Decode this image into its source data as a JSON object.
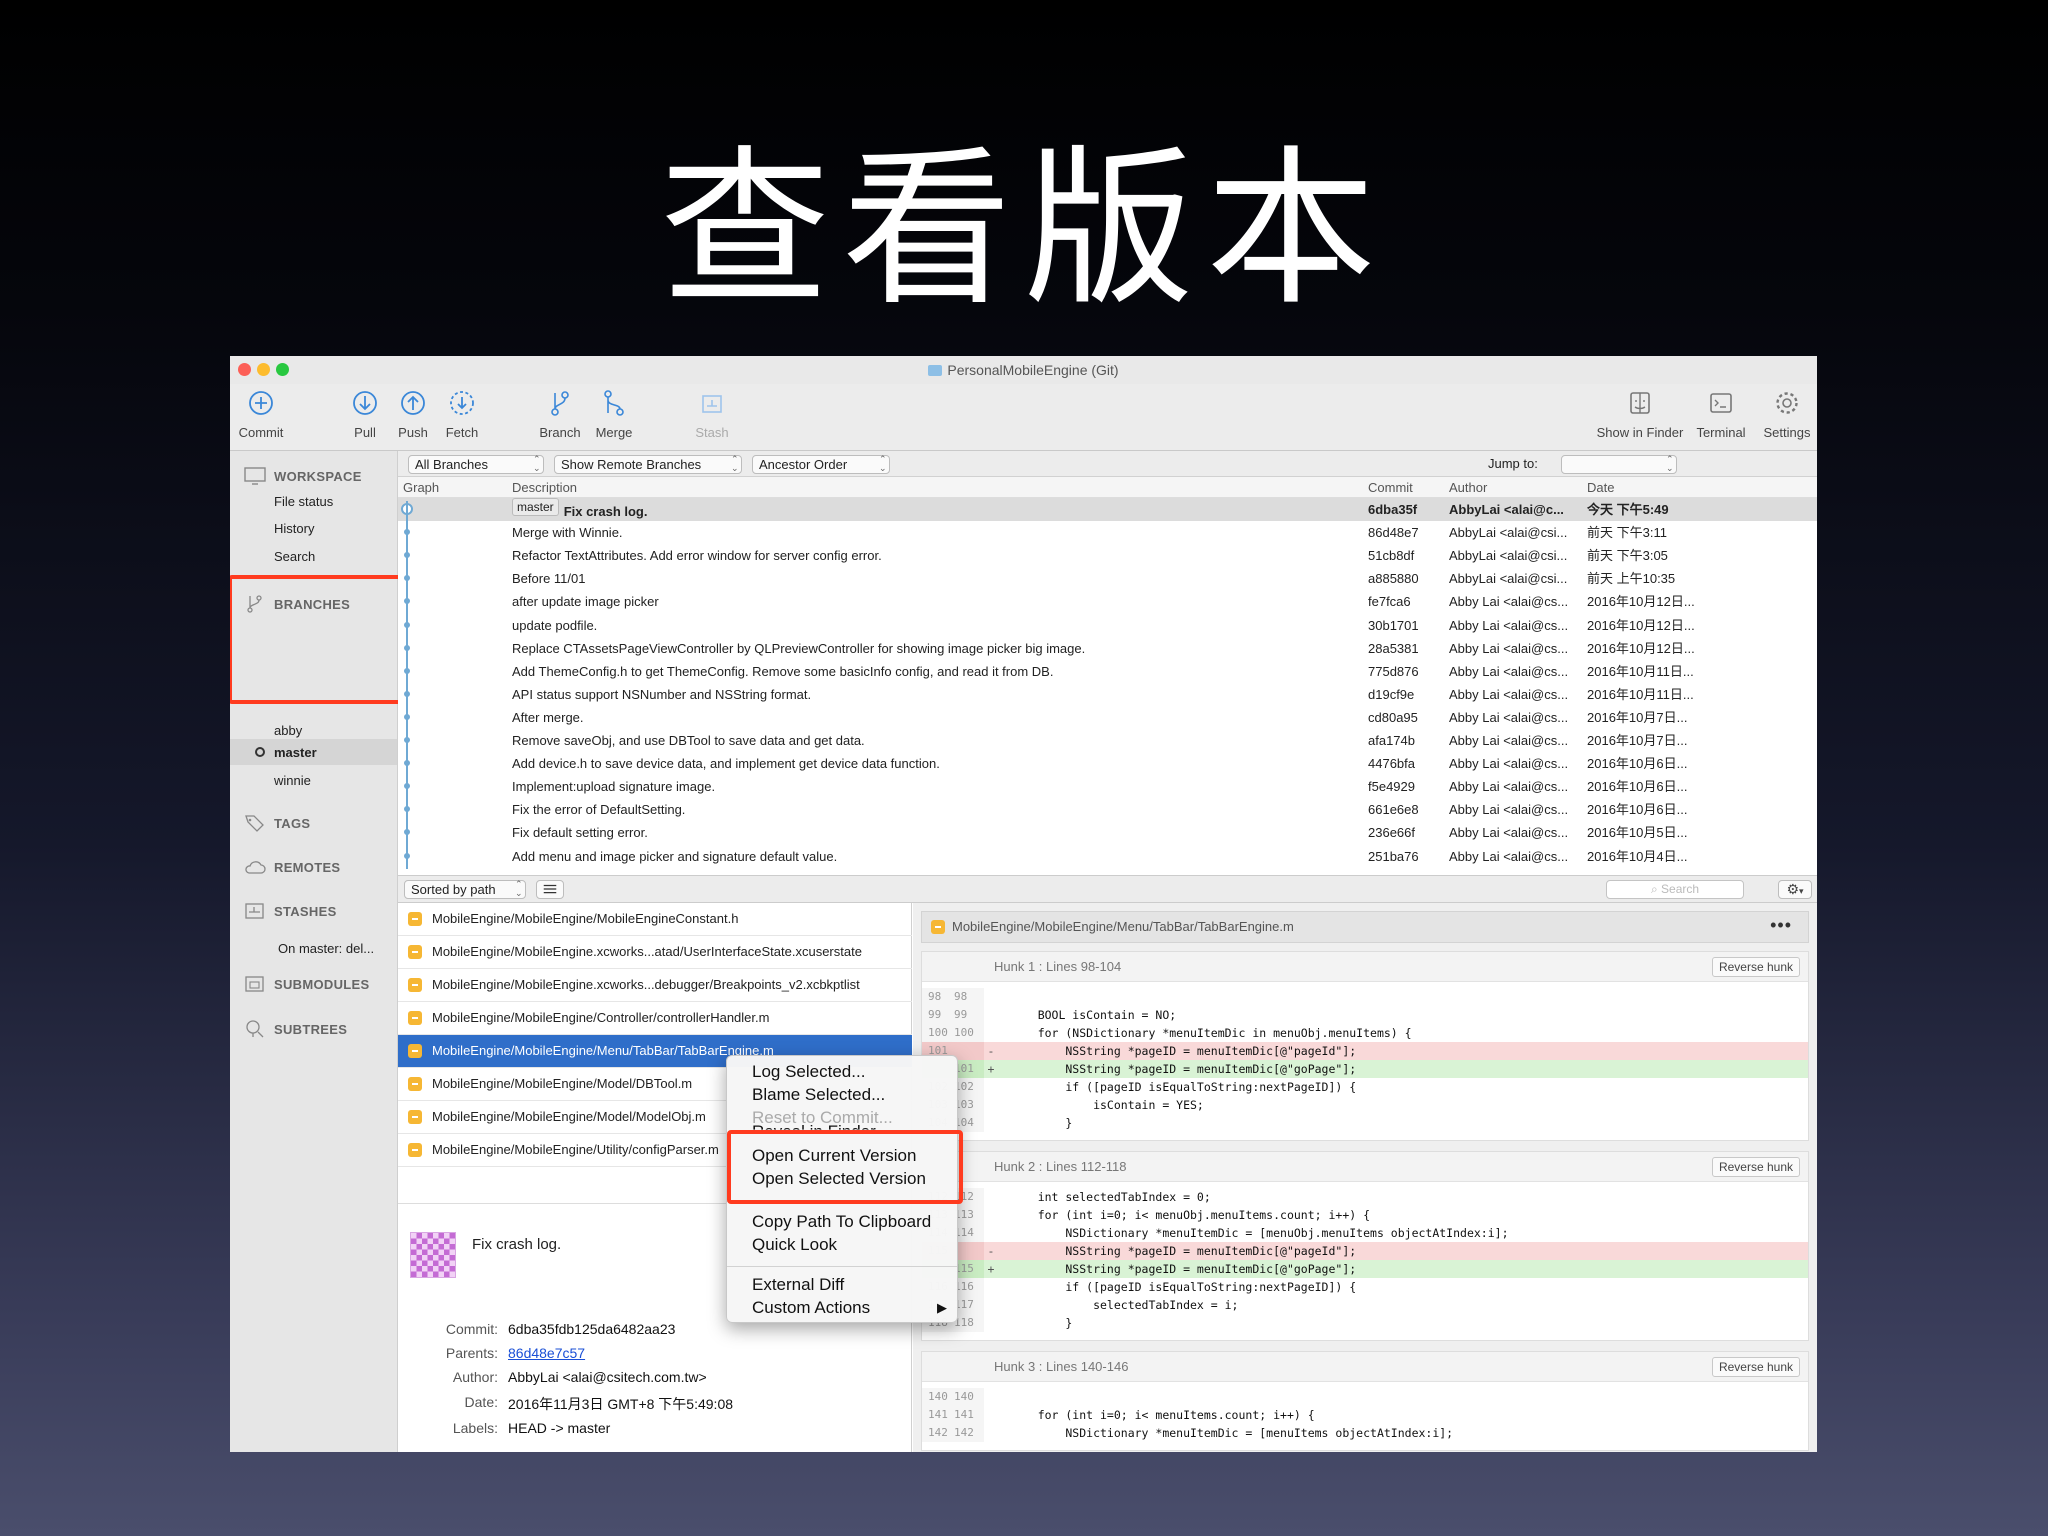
{
  "slide_title": "查看版本",
  "window": {
    "title": "PersonalMobileEngine (Git)"
  },
  "toolbar": {
    "commit": "Commit",
    "pull": "Pull",
    "push": "Push",
    "fetch": "Fetch",
    "branch": "Branch",
    "merge": "Merge",
    "stash": "Stash",
    "show_in_finder": "Show in Finder",
    "terminal": "Terminal",
    "settings": "Settings"
  },
  "sidebar": {
    "workspace": "WORKSPACE",
    "file_status": "File status",
    "history": "History",
    "search": "Search",
    "branches": "BRANCHES",
    "branch_items": [
      "abby",
      "master",
      "winnie"
    ],
    "tags": "TAGS",
    "remotes": "REMOTES",
    "stashes": "STASHES",
    "stash_item": "On master: del...",
    "submodules": "SUBMODULES",
    "subtrees": "SUBTREES"
  },
  "filters": {
    "branches": "All Branches",
    "remote": "Show Remote Branches",
    "order": "Ancestor Order",
    "jump_to": "Jump to:"
  },
  "columns": {
    "graph": "Graph",
    "description": "Description",
    "commit": "Commit",
    "author": "Author",
    "date": "Date"
  },
  "commits": [
    {
      "branch": "master",
      "desc": "Fix crash log.",
      "hash": "6dba35f",
      "author": "AbbyLai <alai@c...",
      "date": "今天 下午5:49"
    },
    {
      "desc": "Merge with Winnie.",
      "hash": "86d48e7",
      "author": "AbbyLai <alai@csi...",
      "date": "前天 下午3:11"
    },
    {
      "desc": "Refactor TextAttributes. Add error window for server config error.",
      "hash": "51cb8df",
      "author": "AbbyLai <alai@csi...",
      "date": "前天 下午3:05"
    },
    {
      "desc": "Before 11/01",
      "hash": "a885880",
      "author": "AbbyLai <alai@csi...",
      "date": "前天 上午10:35"
    },
    {
      "desc": "after update image picker",
      "hash": "fe7fca6",
      "author": "Abby Lai <alai@cs...",
      "date": "2016年10月12日..."
    },
    {
      "desc": "update podfile.",
      "hash": "30b1701",
      "author": "Abby Lai <alai@cs...",
      "date": "2016年10月12日..."
    },
    {
      "desc": "Replace CTAssetsPageViewController by QLPreviewController  for showing image picker big image.",
      "hash": "28a5381",
      "author": "Abby Lai <alai@cs...",
      "date": "2016年10月12日..."
    },
    {
      "desc": "Add ThemeConfig.h to get ThemeConfig. Remove some basicInfo config, and read it from DB.",
      "hash": "775d876",
      "author": "Abby Lai <alai@cs...",
      "date": "2016年10月11日..."
    },
    {
      "desc": "API status support NSNumber and NSString format.",
      "hash": "d19cf9e",
      "author": "Abby Lai <alai@cs...",
      "date": "2016年10月11日..."
    },
    {
      "desc": "After merge.",
      "hash": "cd80a95",
      "author": "Abby Lai <alai@cs...",
      "date": "2016年10月7日..."
    },
    {
      "desc": "Remove saveObj, and use DBTool to save data and get data.",
      "hash": "afa174b",
      "author": "Abby Lai <alai@cs...",
      "date": "2016年10月7日..."
    },
    {
      "desc": "Add device.h to save device data, and implement get device data function.",
      "hash": "4476bfa",
      "author": "Abby Lai <alai@cs...",
      "date": "2016年10月6日..."
    },
    {
      "desc": "Implement:upload signature image.",
      "hash": "f5e4929",
      "author": "Abby Lai <alai@cs...",
      "date": "2016年10月6日..."
    },
    {
      "desc": "Fix the error of DefaultSetting.",
      "hash": "661e6e8",
      "author": "Abby Lai <alai@cs...",
      "date": "2016年10月6日..."
    },
    {
      "desc": "Fix default setting error.",
      "hash": "236e66f",
      "author": "Abby Lai <alai@cs...",
      "date": "2016年10月5日..."
    },
    {
      "desc": "Add menu and image picker and signature default value.",
      "hash": "251ba76",
      "author": "Abby Lai <alai@cs...",
      "date": "2016年10月4日..."
    }
  ],
  "midbar": {
    "sort": "Sorted by path",
    "search_placeholder": "Search"
  },
  "files": [
    "MobileEngine/MobileEngine/MobileEngineConstant.h",
    "MobileEngine/MobileEngine.xcworks...atad/UserInterfaceState.xcuserstate",
    "MobileEngine/MobileEngine.xcworks...debugger/Breakpoints_v2.xcbkptlist",
    "MobileEngine/MobileEngine/Controller/controllerHandler.m",
    "MobileEngine/MobileEngine/Menu/TabBar/TabBarEngine.m",
    "MobileEngine/MobileEngine/Model/DBTool.m",
    "MobileEngine/MobileEngine/Model/ModelObj.m",
    "MobileEngine/MobileEngine/Utility/configParser.m"
  ],
  "detail": {
    "message": "Fix crash log.",
    "commit_label": "Commit:",
    "commit": "6dba35fdb125da6482aa23",
    "parents_label": "Parents:",
    "parents": "86d48e7c57",
    "author_label": "Author:",
    "author": "AbbyLai <alai@csitech.com.tw>",
    "date_label": "Date:",
    "date": "2016年11月3日 GMT+8 下午5:49:08",
    "labels_label": "Labels:",
    "labels": "HEAD -> master"
  },
  "diff": {
    "file": "MobileEngine/MobileEngine/Menu/TabBar/TabBarEngine.m",
    "reverse": "Reverse hunk",
    "hunks": [
      {
        "title": "Hunk 1 : Lines 98-104",
        "lines": [
          {
            "t": "ctx",
            "o": "98",
            "n": "98",
            "c": ""
          },
          {
            "t": "ctx",
            "o": "99",
            "n": "99",
            "c": "    BOOL isContain = NO;"
          },
          {
            "t": "ctx",
            "o": "100",
            "n": "100",
            "c": "    for (NSDictionary *menuItemDic in menuObj.menuItems) {"
          },
          {
            "t": "del",
            "o": "101",
            "n": "",
            "c": "        NSString *pageID = menuItemDic[@\"pageId\"];"
          },
          {
            "t": "add",
            "o": "",
            "n": "101",
            "c": "        NSString *pageID = menuItemDic[@\"goPage\"];"
          },
          {
            "t": "ctx",
            "o": "102",
            "n": "102",
            "c": "        if ([pageID isEqualToString:nextPageID]) {"
          },
          {
            "t": "ctx",
            "o": "103",
            "n": "103",
            "c": "            isContain = YES;"
          },
          {
            "t": "ctx",
            "o": "104",
            "n": "104",
            "c": "        }"
          }
        ]
      },
      {
        "title": "Hunk 2 : Lines 112-118",
        "lines": [
          {
            "t": "ctx",
            "o": "112",
            "n": "112",
            "c": "    int selectedTabIndex = 0;"
          },
          {
            "t": "ctx",
            "o": "113",
            "n": "113",
            "c": "    for (int i=0; i< menuObj.menuItems.count; i++) {"
          },
          {
            "t": "ctx",
            "o": "114",
            "n": "114",
            "c": "        NSDictionary *menuItemDic = [menuObj.menuItems objectAtIndex:i];"
          },
          {
            "t": "del",
            "o": "115",
            "n": "",
            "c": "        NSString *pageID = menuItemDic[@\"pageId\"];"
          },
          {
            "t": "add",
            "o": "",
            "n": "115",
            "c": "        NSString *pageID = menuItemDic[@\"goPage\"];"
          },
          {
            "t": "ctx",
            "o": "116",
            "n": "116",
            "c": "        if ([pageID isEqualToString:nextPageID]) {"
          },
          {
            "t": "ctx",
            "o": "117",
            "n": "117",
            "c": "            selectedTabIndex = i;"
          },
          {
            "t": "ctx",
            "o": "118",
            "n": "118",
            "c": "        }"
          }
        ]
      },
      {
        "title": "Hunk 3 : Lines 140-146",
        "lines": [
          {
            "t": "ctx",
            "o": "140",
            "n": "140",
            "c": ""
          },
          {
            "t": "ctx",
            "o": "141",
            "n": "141",
            "c": "    for (int i=0; i< menuItems.count; i++) {"
          },
          {
            "t": "ctx",
            "o": "142",
            "n": "142",
            "c": "        NSDictionary *menuItemDic = [menuItems objectAtIndex:i];"
          }
        ]
      }
    ]
  },
  "context_menu": {
    "log_selected": "Log Selected...",
    "blame_selected": "Blame Selected...",
    "reset_to_commit": "Reset to Commit...",
    "reveal_in_finder": "Reveal in Finder",
    "open_current": "Open Current Version",
    "open_selected": "Open Selected Version",
    "copy_path": "Copy Path To Clipboard",
    "quick_look": "Quick Look",
    "external_diff": "External Diff",
    "custom_actions": "Custom Actions"
  },
  "colors": {
    "highlight_box": "#ff3b1f",
    "selection_blue": "#2f6ec9",
    "graph_line": "#6fa9d4",
    "file_icon": "#f6b734",
    "deleted_line": "#f9d9d9",
    "added_line": "#d9f3d5"
  }
}
